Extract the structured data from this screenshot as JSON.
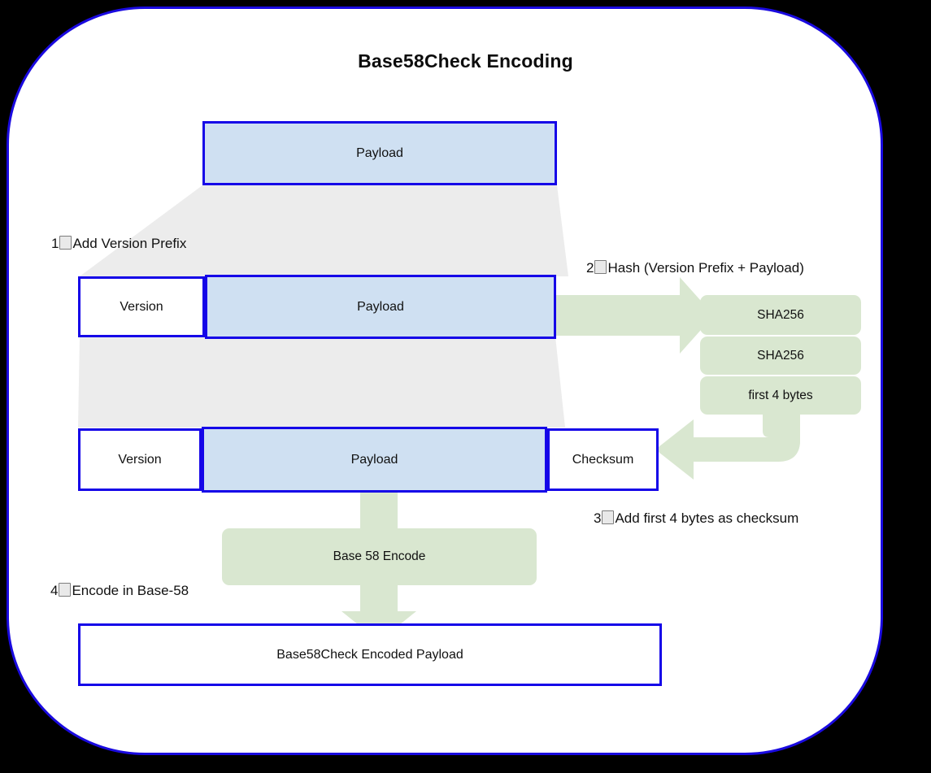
{
  "diagram": {
    "title": "Base58Check Encoding",
    "colors": {
      "background": "#000000",
      "card_background": "#ffffff",
      "card_border": "#1a0ae0",
      "box_border": "#1505e8",
      "payload_fill": "#cfe0f2",
      "process_fill": "#d9e7d0",
      "connector_fill": "#ececec"
    },
    "row1": {
      "payload": "Payload"
    },
    "row2": {
      "version": "Version",
      "payload": "Payload"
    },
    "row3": {
      "version": "Version",
      "payload": "Payload",
      "checksum": "Checksum"
    },
    "hash_chain": [
      {
        "label": "SHA256"
      },
      {
        "label": "SHA256"
      },
      {
        "label": "first 4 bytes"
      }
    ],
    "encode": {
      "label": "Base 58 Encode"
    },
    "output": {
      "label": "Base58Check Encoded Payload"
    },
    "steps": [
      {
        "number": "1",
        "glyph": "missing-glyph-box",
        "label": "Add Version Prefix"
      },
      {
        "number": "2",
        "glyph": "missing-glyph-box",
        "label": "Hash (Version Prefix + Payload)"
      },
      {
        "number": "3",
        "glyph": "missing-glyph-box",
        "label": "Add first 4 bytes as checksum"
      },
      {
        "number": "4",
        "glyph": "missing-glyph-box",
        "label": "Encode in Base-58"
      }
    ]
  }
}
